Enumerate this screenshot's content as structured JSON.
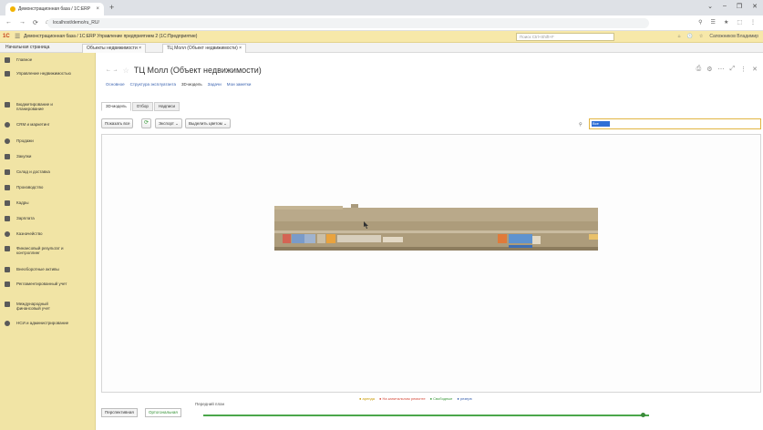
{
  "browser": {
    "tab_title": "Демонстрационная база / 1С:ERP",
    "tab_close": "×",
    "new_tab": "+",
    "url": "localhost/demo/ru_RU/",
    "window_controls": [
      "⌄",
      "–",
      "❐",
      "✕"
    ],
    "nav": [
      "←",
      "→",
      "⟳",
      "⌂"
    ],
    "extensions": [
      "⚲",
      "☰",
      "★",
      "⬚",
      "⋮"
    ]
  },
  "onec": {
    "logo": "1С",
    "menu_glyph": "☰",
    "title": "Демонстрационная база / 1С:ERP Управление предприятием 2 (1С:Предприятие)",
    "search_placeholder": "Поиск Ctrl+Shift+F",
    "right": [
      "⌂",
      "🕓",
      "☆",
      "Сапожников Владимир"
    ]
  },
  "open_tabs": [
    {
      "label": "Начальная страница"
    },
    {
      "label": "Объекты недвижимости ×"
    },
    {
      "label": "ТЦ Молл (Объект недвижимости) ×"
    }
  ],
  "sidebar": {
    "items": [
      {
        "label": "Главное"
      },
      {
        "label": "Управление недвижимостью"
      },
      {
        "label": "Бюджетирование и планирование"
      },
      {
        "label": "CRM и маркетинг"
      },
      {
        "label": "Продажи"
      },
      {
        "label": "Закупки"
      },
      {
        "label": "Склад и доставка"
      },
      {
        "label": "Производство"
      },
      {
        "label": "Кадры"
      },
      {
        "label": "Зарплата"
      },
      {
        "label": "Казначейство"
      },
      {
        "label": "Финансовый результат и контроллинг"
      },
      {
        "label": "Внеоборотные активы"
      },
      {
        "label": "Регламентированный учет"
      },
      {
        "label": "Международный финансовый учет"
      },
      {
        "label": "НСИ и администрирование"
      }
    ]
  },
  "form": {
    "nav_arrows": "← →",
    "star": "☆",
    "title": "ТЦ Молл (Объект недвижимости)",
    "right_icons": [
      "⎙",
      "⚙",
      "⋯",
      "⤢",
      "⋮",
      "✕"
    ],
    "links": [
      "Основное",
      "Структура эксплуатанта",
      "3D-модель",
      "Задачи",
      "Мои заметки"
    ],
    "current_link": "3D-модель",
    "inner_tabs": [
      "3D-модель",
      "Отбор",
      "Надписи"
    ],
    "buttons": {
      "show_all": "Показать все",
      "refresh": "⟳",
      "export": "Экспорт ⌄",
      "highlight": "Выделить цветом ⌄"
    },
    "search_label": "⚲",
    "search_value": "Все"
  },
  "legend": [
    {
      "label": "● аренда",
      "color": "#e8b400"
    },
    {
      "label": "● На капитальном ремонте",
      "color": "#d64a3a"
    },
    {
      "label": "● Свободные",
      "color": "#4aa64a"
    },
    {
      "label": "● резерв",
      "color": "#3b63b0"
    }
  ],
  "bottom": {
    "btn_perspective": "Перспективная",
    "btn_ortho": "Ортогональная",
    "plane_label": "Передний план",
    "slider_value": 0.985
  }
}
